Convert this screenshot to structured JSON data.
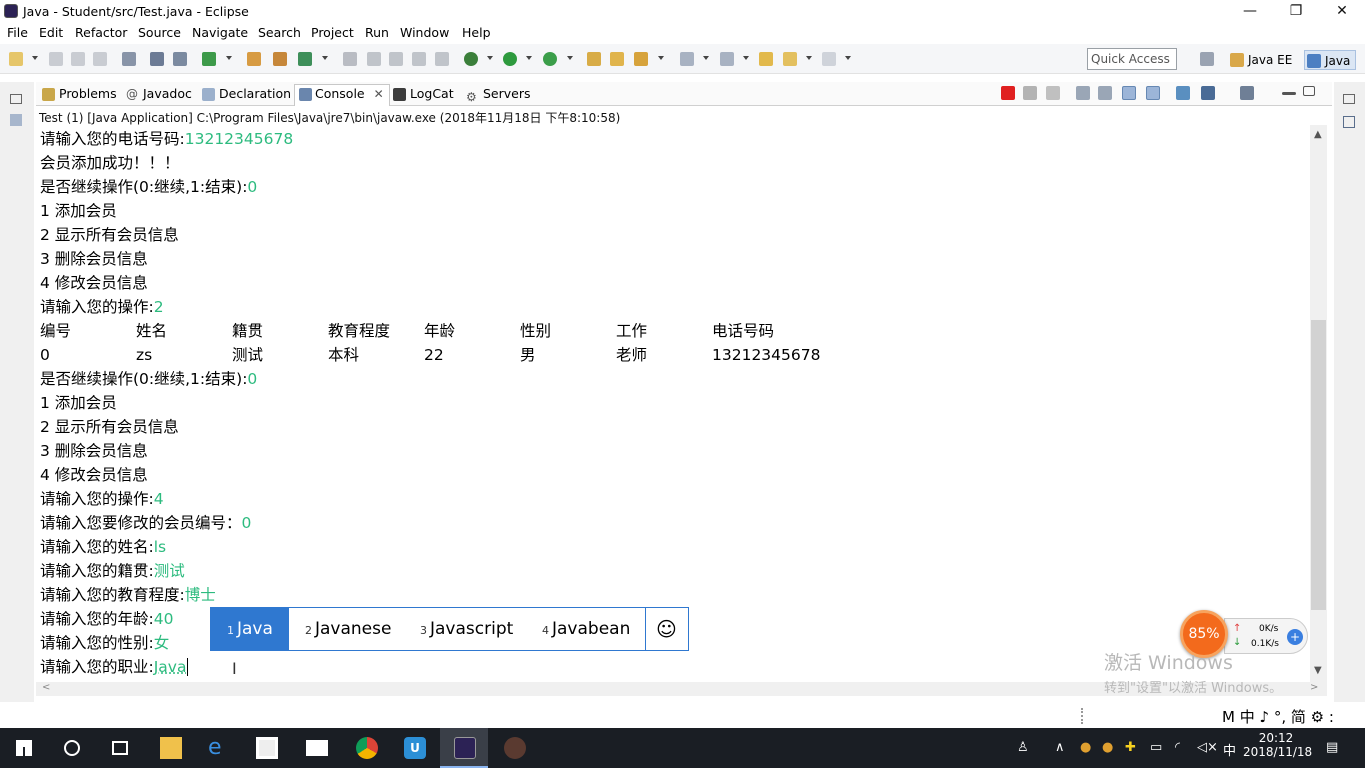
{
  "window": {
    "title": "Java - Student/src/Test.java - Eclipse"
  },
  "menu": [
    "File",
    "Edit",
    "Refactor",
    "Source",
    "Navigate",
    "Search",
    "Project",
    "Run",
    "Window",
    "Help"
  ],
  "toolbar": {
    "quick_access_placeholder": "Quick Access",
    "perspectives": [
      "Java EE",
      "Java"
    ]
  },
  "view_tabs": [
    "Problems",
    "Javadoc",
    "Declaration",
    "Console",
    "LogCat",
    "Servers"
  ],
  "console": {
    "header": "Test (1) [Java Application] C:\\Program Files\\Java\\jre7\\bin\\javaw.exe (2018年11月18日 下午8:10:58)",
    "lines": [
      {
        "p": "请输入您的电话号码:",
        "i": "13212345678"
      },
      {
        "p": "会员添加成功！！！",
        "i": ""
      },
      {
        "p": "是否继续操作(0:继续,1:结束):",
        "i": "0"
      },
      {
        "p": "1 添加会员",
        "i": ""
      },
      {
        "p": "2 显示所有会员信息",
        "i": ""
      },
      {
        "p": "3 删除会员信息",
        "i": ""
      },
      {
        "p": "4 修改会员信息",
        "i": ""
      },
      {
        "p": "请输入您的操作:",
        "i": "2"
      },
      {
        "p": "",
        "i": ""
      },
      {
        "p": "",
        "i": ""
      },
      {
        "p": "是否继续操作(0:继续,1:结束):",
        "i": "0"
      },
      {
        "p": "1 添加会员",
        "i": ""
      },
      {
        "p": "2 显示所有会员信息",
        "i": ""
      },
      {
        "p": "3 删除会员信息",
        "i": ""
      },
      {
        "p": "4 修改会员信息",
        "i": ""
      },
      {
        "p": "请输入您的操作:",
        "i": "4"
      },
      {
        "p": "请输入您要修改的会员编号：",
        "i": "0"
      },
      {
        "p": "请输入您的姓名:",
        "i": "ls"
      },
      {
        "p": "请输入您的籍贯:",
        "i": "测试"
      },
      {
        "p": "请输入您的教育程度:",
        "i": "博士"
      },
      {
        "p": "请输入您的年龄:",
        "i": "40"
      },
      {
        "p": "请输入您的性别:",
        "i": "女"
      },
      {
        "p": "请输入您的职业:",
        "i": "Java"
      }
    ],
    "table": {
      "headers": [
        "编号",
        "姓名",
        "籍贯",
        "教育程度",
        "年龄",
        "性别",
        "工作",
        "电话号码"
      ],
      "row": [
        "0",
        "zs",
        "测试",
        "本科",
        "22",
        "男",
        "老师",
        "13212345678"
      ]
    }
  },
  "ime": {
    "candidates": [
      {
        "n": "1",
        "t": "Java"
      },
      {
        "n": "2",
        "t": "Javanese"
      },
      {
        "n": "3",
        "t": "Javascript"
      },
      {
        "n": "4",
        "t": "Javabean"
      }
    ],
    "emoji": "☺"
  },
  "net_monitor": {
    "percent": "85%",
    "up": "0K/s",
    "down": "0.1K/s"
  },
  "watermark": {
    "line1": "激活 Windows",
    "line2": "转到\"设置\"以激活 Windows。"
  },
  "ime_bar": "M 中 ♪ °, 简 ⚙ :",
  "taskbar": {
    "time": "20:12",
    "date": "2018/11/18",
    "lang": "中"
  }
}
